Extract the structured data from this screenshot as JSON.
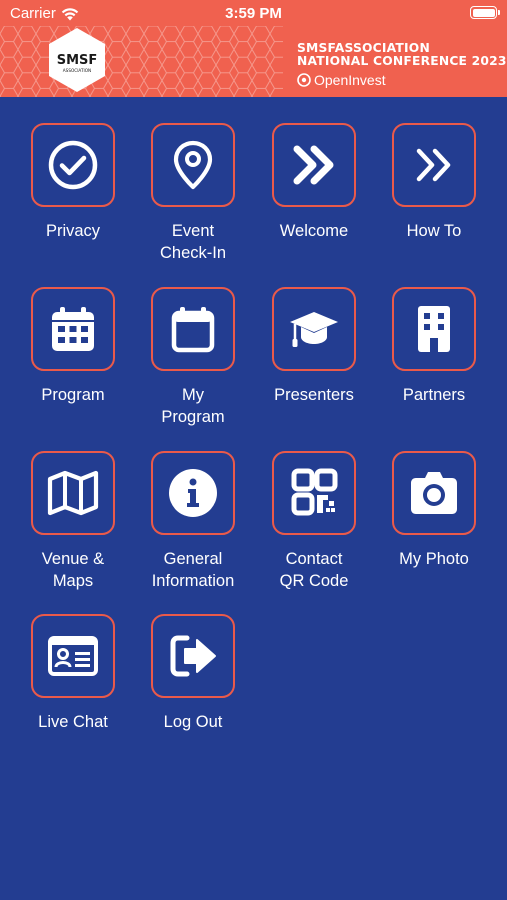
{
  "status_bar": {
    "carrier": "Carrier",
    "time": "3:59 PM",
    "battery_level": 1.0
  },
  "banner": {
    "logo_text": "SMSF",
    "logo_subtext": "ASSOCIATION",
    "conference_line1": "SMSFASSOCIATION",
    "conference_line2": "NATIONAL CONFERENCE 2023",
    "sponsor": "OpenInvest"
  },
  "colors": {
    "background": "#233d91",
    "accent": "#f0614f",
    "tile_border": "#ea5a4a",
    "icon": "#ffffff"
  },
  "tiles": [
    {
      "label": "Privacy",
      "icon": "check-circle-icon"
    },
    {
      "label": "Event\nCheck-In",
      "icon": "map-pin-icon"
    },
    {
      "label": "Welcome",
      "icon": "double-chevron-bold-icon"
    },
    {
      "label": "How To",
      "icon": "double-chevron-icon"
    },
    {
      "label": "Program",
      "icon": "calendar-grid-icon"
    },
    {
      "label": "My\nProgram",
      "icon": "calendar-icon"
    },
    {
      "label": "Presenters",
      "icon": "graduation-cap-icon"
    },
    {
      "label": "Partners",
      "icon": "building-icon"
    },
    {
      "label": "Venue &\nMaps",
      "icon": "map-icon"
    },
    {
      "label": "General\nInformation",
      "icon": "info-icon"
    },
    {
      "label": "Contact\nQR Code",
      "icon": "qr-code-icon"
    },
    {
      "label": "My Photo",
      "icon": "camera-icon"
    },
    {
      "label": "Live Chat",
      "icon": "id-card-icon"
    },
    {
      "label": "Log Out",
      "icon": "logout-icon"
    }
  ]
}
